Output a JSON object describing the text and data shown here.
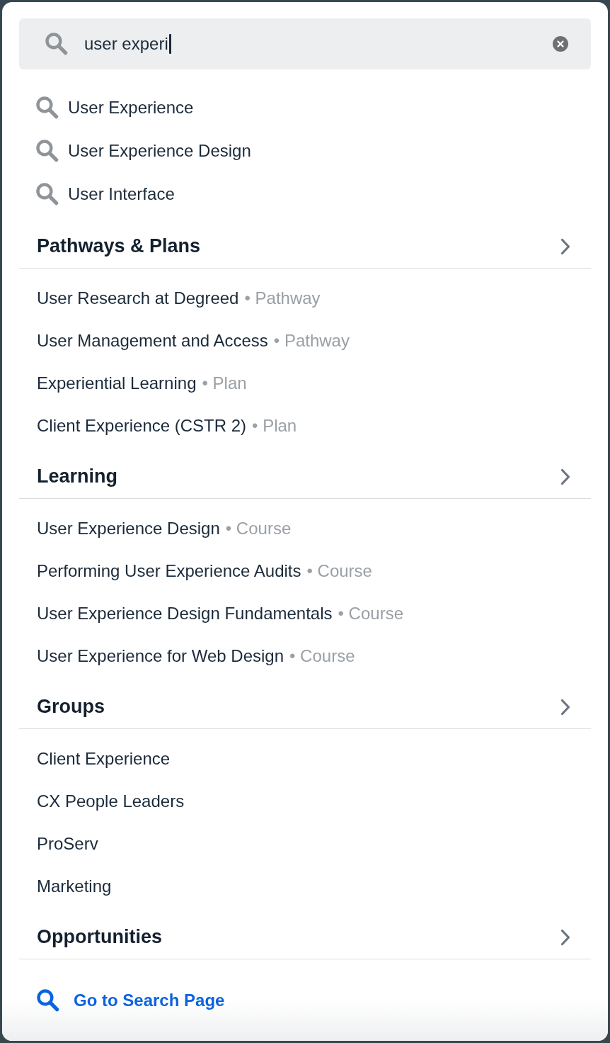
{
  "search": {
    "value": "user experi"
  },
  "suggestions": [
    "User Experience",
    "User Experience Design",
    "User Interface"
  ],
  "sections": [
    {
      "title": "Pathways & Plans",
      "items": [
        {
          "title": "User Research at Degreed",
          "type": "• Pathway"
        },
        {
          "title": "User Management and Access",
          "type": "• Pathway"
        },
        {
          "title": "Experiential Learning",
          "type": "• Plan"
        },
        {
          "title": "Client Experience (CSTR 2)",
          "type": "• Plan"
        }
      ]
    },
    {
      "title": "Learning",
      "items": [
        {
          "title": "User Experience Design",
          "type": "• Course"
        },
        {
          "title": "Performing User Experience Audits",
          "type": "• Course"
        },
        {
          "title": "User Experience Design Fundamentals",
          "type": "• Course"
        },
        {
          "title": "User Experience for Web Design",
          "type": "• Course"
        }
      ]
    },
    {
      "title": "Groups",
      "items": [
        {
          "title": "Client Experience"
        },
        {
          "title": "CX People Leaders"
        },
        {
          "title": "ProServ"
        },
        {
          "title": "Marketing"
        }
      ]
    },
    {
      "title": "Opportunities"
    }
  ],
  "footer_link": {
    "label": "Go to Search Page"
  }
}
